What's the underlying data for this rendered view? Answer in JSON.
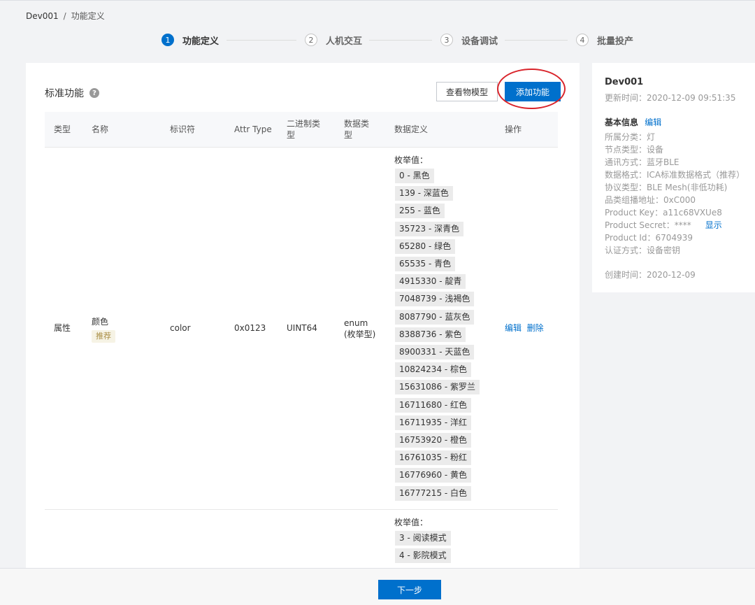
{
  "breadcrumb": {
    "root": "Dev001",
    "separator": "/",
    "current": "功能定义"
  },
  "steps": [
    {
      "num": "1",
      "label": "功能定义"
    },
    {
      "num": "2",
      "label": "人机交互"
    },
    {
      "num": "3",
      "label": "设备调试"
    },
    {
      "num": "4",
      "label": "批量投产"
    }
  ],
  "main": {
    "title": "标准功能",
    "help_icon": "?",
    "view_model_label": "查看物模型",
    "add_feature_label": "添加功能"
  },
  "table": {
    "headers": {
      "type": "类型",
      "name": "名称",
      "identifier": "标识符",
      "attr_type": "Attr Type",
      "binary_type_1": "二进制类",
      "binary_type_2": "型",
      "data_type_1": "数据类",
      "data_type_2": "型",
      "data_def": "数据定义",
      "actions": "操作"
    },
    "row1": {
      "type": "属性",
      "name": "颜色",
      "badge": "推荐",
      "identifier": "color",
      "attr_type": "0x0123",
      "binary_type": "UINT64",
      "data_type_1": "enum",
      "data_type_2": "(枚举型)",
      "enum_label": "枚举值：",
      "enum_values": [
        "0 - 黑色",
        "139 - 深蓝色",
        "255 - 蓝色",
        "35723 - 深青色",
        "65280 - 绿色",
        "65535 - 青色",
        "4915330 - 靛青",
        "7048739 - 浅褐色",
        "8087790 - 蓝灰色",
        "8388736 - 紫色",
        "8900331 - 天蓝色",
        "10824234 - 棕色",
        "15631086 - 紫罗兰",
        "16711680 - 红色",
        "16711935 - 洋红",
        "16753920 - 橙色",
        "16761035 - 粉红",
        "16776960 - 黄色",
        "16777215 - 白色"
      ],
      "edit_label": "编辑",
      "delete_label": "删除"
    },
    "row2": {
      "enum_label": "枚举值：",
      "enum_values": [
        "3 - 阅读模式",
        "4 - 影院模式"
      ]
    }
  },
  "sidebar": {
    "title": "Dev001",
    "updated": "更新时间：2020-12-09 09:51:35",
    "section_title": "基本信息",
    "edit_label": "编辑",
    "lines": [
      "所属分类：灯",
      "节点类型：设备",
      "通讯方式：蓝牙BLE",
      "数据格式：ICA标准数据格式（推荐）",
      "协议类型：BLE Mesh(非低功耗)",
      "品类组播地址：0xC000",
      "Product Key：a11c68VXUe8",
      "Product Secret：****",
      "Product Id：6704939",
      "认证方式：设备密钥"
    ],
    "show_label": "显示",
    "created": "创建时间：2020-12-09"
  },
  "footer": {
    "next_label": "下一步"
  },
  "colors": {
    "primary": "#0070cc",
    "highlight_circle": "#d9242b"
  }
}
